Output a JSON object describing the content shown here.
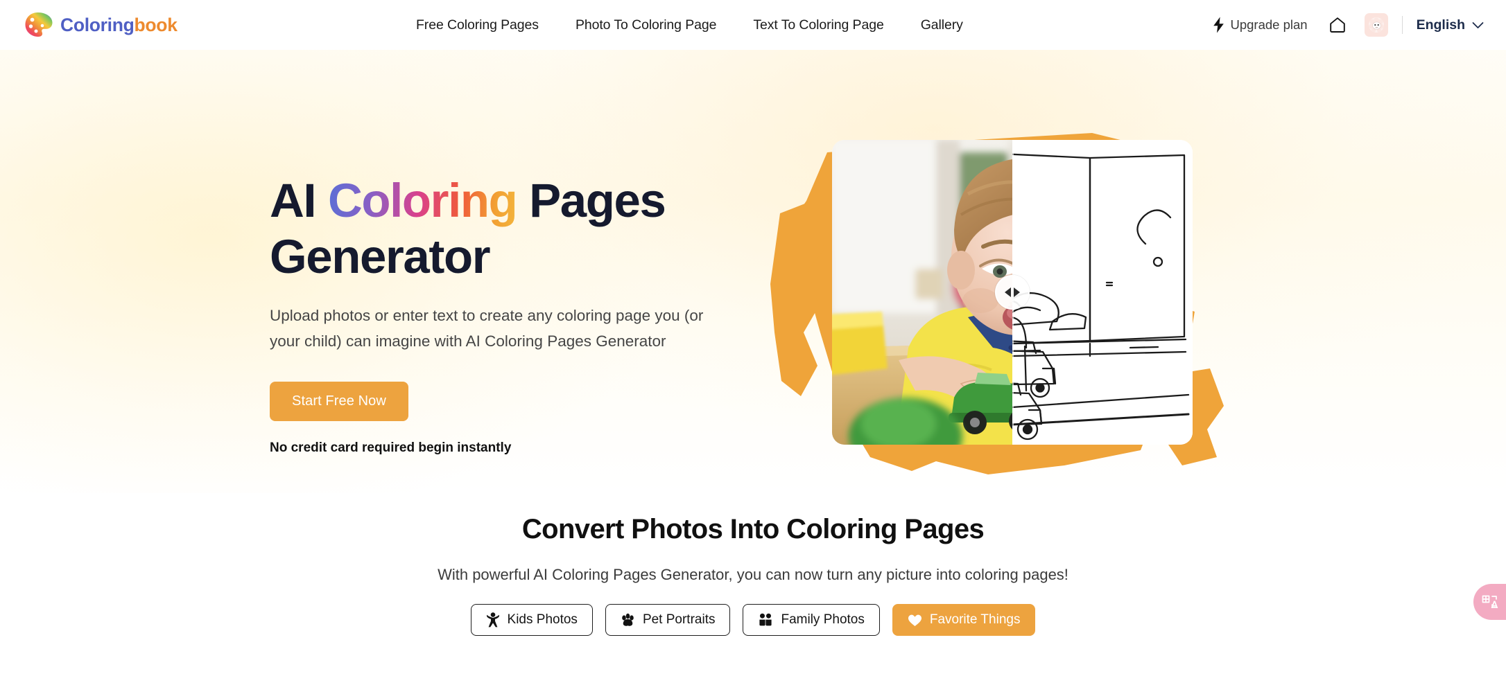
{
  "brand": {
    "name_part1": "Coloring",
    "name_part2": "book",
    "logo_icon": "palette-icon",
    "color_part1": "#4f5fc4",
    "color_part2": "#ed8a2e"
  },
  "nav": {
    "items": [
      {
        "label": "Free Coloring Pages"
      },
      {
        "label": "Photo To Coloring Page"
      },
      {
        "label": "Text To Coloring Page"
      },
      {
        "label": "Gallery"
      }
    ]
  },
  "header_right": {
    "upgrade_label": "Upgrade plan",
    "upgrade_icon": "lightning-bolt-icon",
    "home_icon": "home-icon",
    "avatar_icon": "sheep-avatar-icon",
    "language_label": "English",
    "language_chevron": "chevron-down-icon"
  },
  "hero": {
    "title_part1": "AI ",
    "title_gradient": "Coloring",
    "title_part2": " Pages",
    "title_line2": "Generator",
    "subtitle": "Upload photos or enter text to create any coloring page you (or your child) can imagine with AI Coloring Pages Generator",
    "cta_label": "Start Free Now",
    "note": "No credit card required begin instantly",
    "accent_color": "#eda33f",
    "brush_color": "#efa43a",
    "compare": {
      "before_alt": "Photo of a child playing with toy cars",
      "after_alt": "Line-art coloring page of toy cars in a room",
      "slider_position": "50%",
      "handle_icon": "left-right-arrows-icon"
    }
  },
  "section": {
    "title": "Convert Photos Into Coloring Pages",
    "subtitle": "With powerful AI Coloring Pages Generator, you can now turn any picture into coloring pages!",
    "chips": [
      {
        "label": "Kids Photos",
        "icon": "child-icon",
        "active": false
      },
      {
        "label": "Pet Portraits",
        "icon": "paw-icon",
        "active": false
      },
      {
        "label": "Family Photos",
        "icon": "people-icon",
        "active": false
      },
      {
        "label": "Favorite Things",
        "icon": "heart-icon",
        "active": true
      }
    ]
  },
  "translate_widget": {
    "icon": "translate-icon",
    "label": "中A",
    "color": "#f3abc2"
  }
}
